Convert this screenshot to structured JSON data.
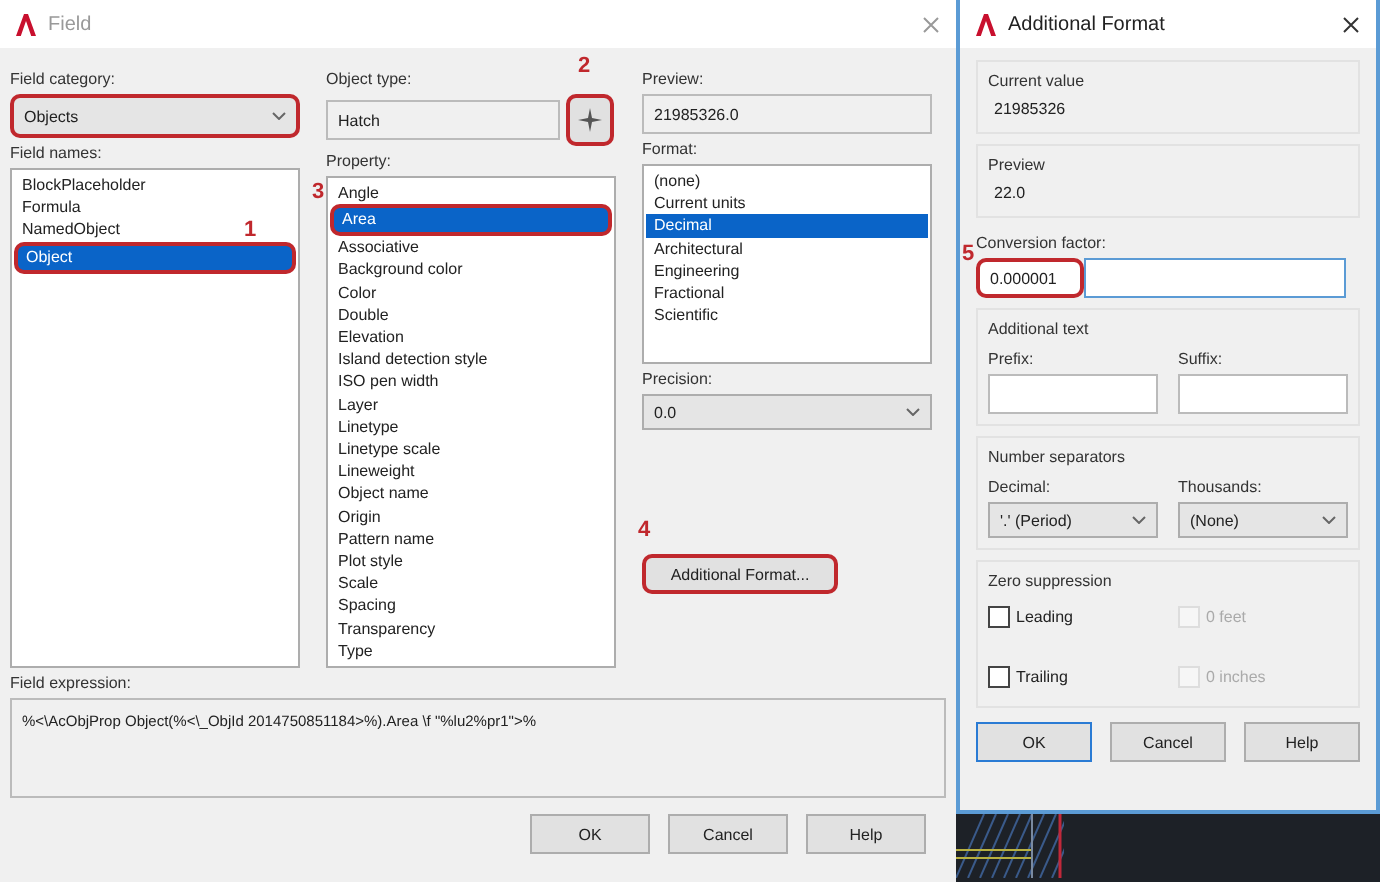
{
  "field_dialog": {
    "title": "Field",
    "field_category": {
      "label": "Field category:",
      "value": "Objects",
      "highlighted": true
    },
    "field_names": {
      "label": "Field names:",
      "items": [
        {
          "label": "BlockPlaceholder",
          "selected": false,
          "highlighted": false
        },
        {
          "label": "Formula",
          "selected": false,
          "highlighted": false
        },
        {
          "label": "NamedObject",
          "selected": false,
          "highlighted": false
        },
        {
          "label": "Object",
          "selected": true,
          "highlighted": true,
          "marker": "1"
        }
      ]
    },
    "object_type": {
      "label": "Object type:",
      "value": "Hatch"
    },
    "pick_button": {
      "highlighted": true,
      "marker": "2"
    },
    "property": {
      "label": "Property:",
      "items": [
        {
          "label": "Angle",
          "selected": false,
          "highlighted": false
        },
        {
          "label": "Area",
          "selected": true,
          "highlighted": true,
          "marker": "3"
        },
        {
          "label": "Associative",
          "selected": false,
          "highlighted": false
        },
        {
          "label": "Background color",
          "selected": false,
          "highlighted": false
        },
        {
          "label": "Color",
          "selected": false,
          "highlighted": false
        },
        {
          "label": "Double",
          "selected": false,
          "highlighted": false
        },
        {
          "label": "Elevation",
          "selected": false,
          "highlighted": false
        },
        {
          "label": "Island detection style",
          "selected": false,
          "highlighted": false
        },
        {
          "label": "ISO pen width",
          "selected": false,
          "highlighted": false
        },
        {
          "label": "Layer",
          "selected": false,
          "highlighted": false
        },
        {
          "label": "Linetype",
          "selected": false,
          "highlighted": false
        },
        {
          "label": "Linetype scale",
          "selected": false,
          "highlighted": false
        },
        {
          "label": "Lineweight",
          "selected": false,
          "highlighted": false
        },
        {
          "label": "Object name",
          "selected": false,
          "highlighted": false
        },
        {
          "label": "Origin",
          "selected": false,
          "highlighted": false
        },
        {
          "label": "Pattern name",
          "selected": false,
          "highlighted": false
        },
        {
          "label": "Plot style",
          "selected": false,
          "highlighted": false
        },
        {
          "label": "Scale",
          "selected": false,
          "highlighted": false
        },
        {
          "label": "Spacing",
          "selected": false,
          "highlighted": false
        },
        {
          "label": "Transparency",
          "selected": false,
          "highlighted": false
        },
        {
          "label": "Type",
          "selected": false,
          "highlighted": false
        }
      ]
    },
    "preview": {
      "label": "Preview:",
      "value": "21985326.0"
    },
    "format": {
      "label": "Format:",
      "items": [
        {
          "label": "(none)",
          "selected": false,
          "highlighted": false
        },
        {
          "label": "Current units",
          "selected": false,
          "highlighted": false
        },
        {
          "label": "Decimal",
          "selected": true,
          "highlighted": false
        },
        {
          "label": "Architectural",
          "selected": false,
          "highlighted": false
        },
        {
          "label": "Engineering",
          "selected": false,
          "highlighted": false
        },
        {
          "label": "Fractional",
          "selected": false,
          "highlighted": false
        },
        {
          "label": "Scientific",
          "selected": false,
          "highlighted": false
        }
      ]
    },
    "precision": {
      "label": "Precision:",
      "value": "0.0"
    },
    "additional_format_button": {
      "label": "Additional Format...",
      "highlighted": true,
      "marker": "4"
    },
    "field_expression": {
      "label": "Field expression:",
      "value": "%<\\AcObjProp Object(%<\\_ObjId 2014750851184>%).Area \\f \"%lu2%pr1\">%"
    },
    "buttons": [
      {
        "label": "OK",
        "default": false
      },
      {
        "label": "Cancel",
        "default": false
      },
      {
        "label": "Help",
        "default": false
      }
    ]
  },
  "additional_format_dialog": {
    "title": "Additional Format",
    "current_value": {
      "label": "Current value",
      "value": "21985326"
    },
    "preview": {
      "label": "Preview",
      "value": "22.0"
    },
    "conversion_factor": {
      "label": "Conversion factor:",
      "value": "0.000001",
      "highlighted": true,
      "marker": "5"
    },
    "additional_text": {
      "label": "Additional text",
      "prefix": {
        "label": "Prefix:"
      },
      "suffix": {
        "label": "Suffix:"
      }
    },
    "number_separators": {
      "label": "Number separators",
      "decimal": {
        "label": "Decimal:",
        "value": "'.' (Period)"
      },
      "thousands": {
        "label": "Thousands:",
        "value": "(None)"
      }
    },
    "zero_suppression": {
      "label": "Zero suppression",
      "options": [
        {
          "label": "Leading",
          "checked": false,
          "disabled": false
        },
        {
          "label": "0 feet",
          "checked": false,
          "disabled": true
        },
        {
          "label": "Trailing",
          "checked": false,
          "disabled": false
        },
        {
          "label": "0 inches",
          "checked": false,
          "disabled": true
        }
      ]
    },
    "buttons": [
      {
        "label": "OK",
        "default": true
      },
      {
        "label": "Cancel",
        "default": false
      },
      {
        "label": "Help",
        "default": false
      }
    ]
  }
}
